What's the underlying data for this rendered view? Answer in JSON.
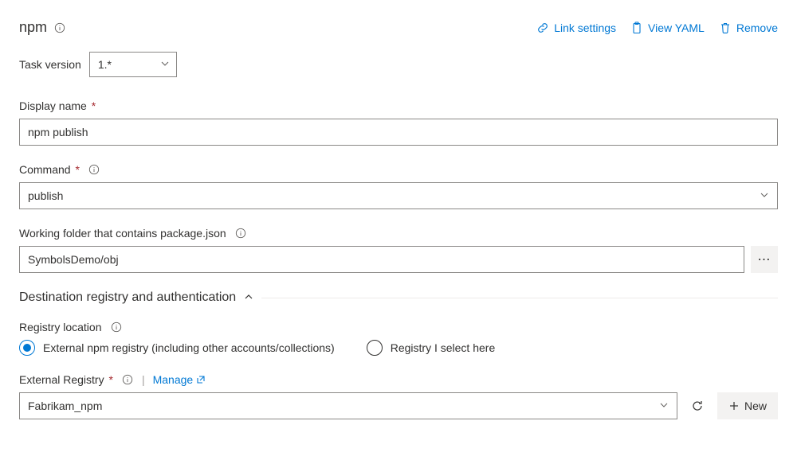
{
  "header": {
    "title": "npm",
    "actions": {
      "link_settings": "Link settings",
      "view_yaml": "View YAML",
      "remove": "Remove"
    }
  },
  "task_version": {
    "label": "Task version",
    "value": "1.*"
  },
  "display_name": {
    "label": "Display name",
    "value": "npm publish"
  },
  "command": {
    "label": "Command",
    "value": "publish"
  },
  "working_folder": {
    "label": "Working folder that contains package.json",
    "value": "SymbolsDemo/obj"
  },
  "section": {
    "title": "Destination registry and authentication"
  },
  "registry_location": {
    "label": "Registry location",
    "option_external": "External npm registry (including other accounts/collections)",
    "option_select_here": "Registry I select here",
    "selected": "external"
  },
  "external_registry": {
    "label": "External Registry",
    "manage": "Manage",
    "value": "Fabrikam_npm",
    "new_label": "New"
  }
}
